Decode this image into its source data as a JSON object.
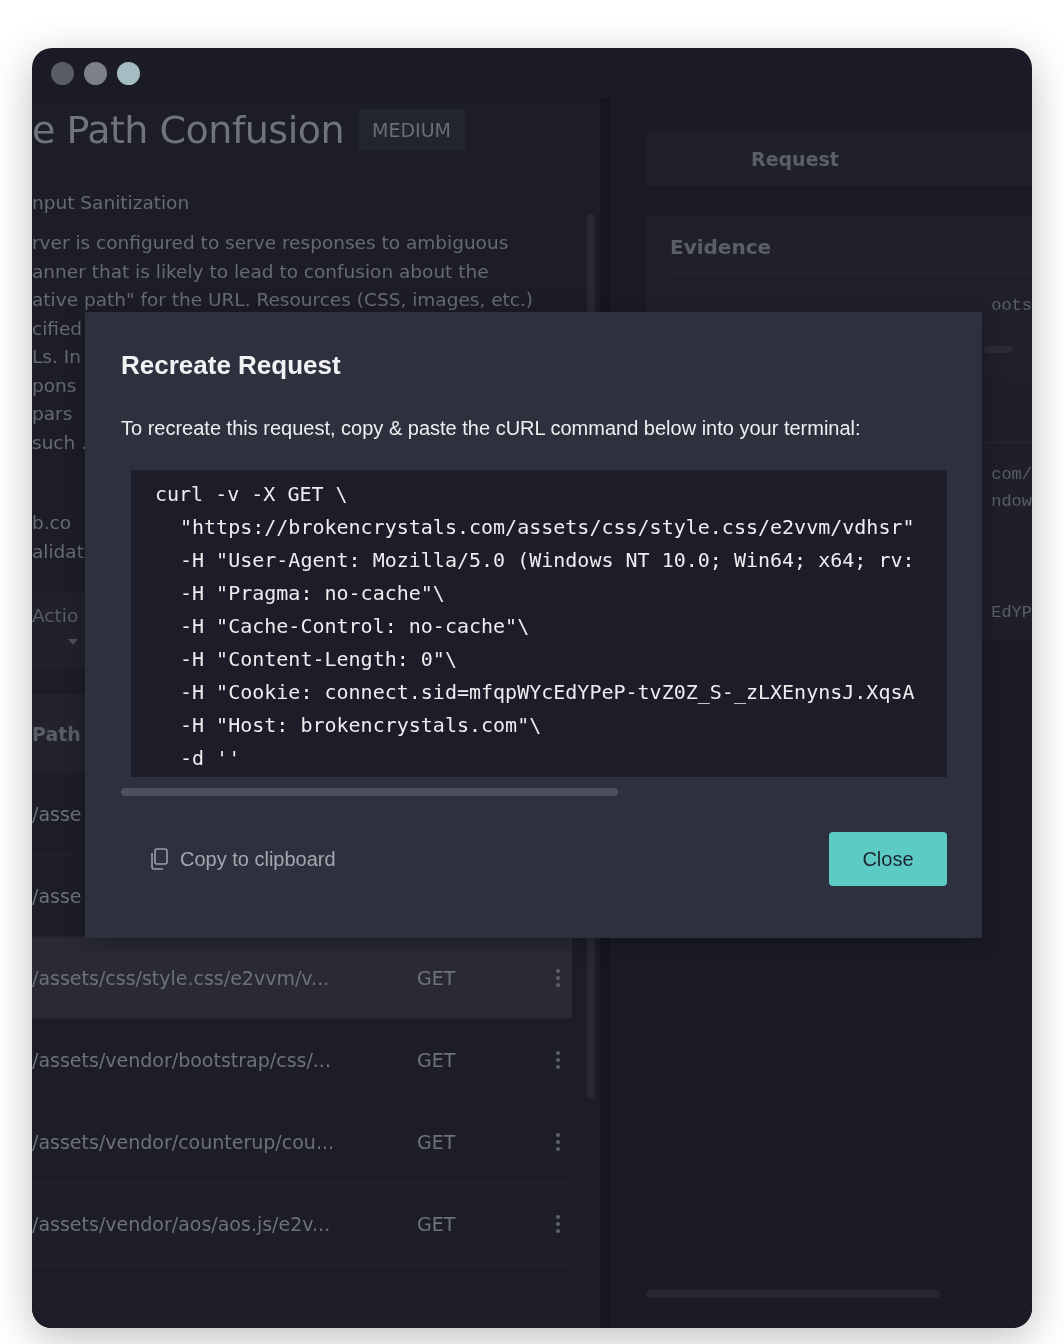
{
  "finding": {
    "title": "e Path Confusion",
    "severity": "MEDIUM",
    "category": "nput Sanitization",
    "description_lines": [
      "rver is configured to serve responses to ambiguous",
      "anner that is likely to lead to confusion about the",
      "ative path\" for the URL. Resources (CSS, images, etc.)",
      "cified",
      "Ls. In",
      "pons",
      "pars",
      "such ."
    ],
    "extra_lines": [
      "b.co",
      "alidat"
    ]
  },
  "actions_dropdown": {
    "label": "Actio"
  },
  "requests_table": {
    "columns": [
      "Path"
    ],
    "rows": [
      {
        "path": "/asse",
        "method": "",
        "selected": false
      },
      {
        "path": "/asse",
        "method": "",
        "selected": false
      },
      {
        "path": "/assets/css/style.css/e2vvm/v...",
        "method": "GET",
        "selected": true
      },
      {
        "path": "/assets/vendor/bootstrap/css/...",
        "method": "GET",
        "selected": false
      },
      {
        "path": "/assets/vendor/counterup/cou...",
        "method": "GET",
        "selected": false
      },
      {
        "path": "/assets/vendor/aos/aos.js/e2v...",
        "method": "GET",
        "selected": false
      }
    ]
  },
  "detail": {
    "request_button": "Request",
    "evidence": {
      "title": "Evidence",
      "code_fragment": "oots"
    },
    "code_fragments": [
      "com/",
      "ndow",
      "EdYP"
    ]
  },
  "modal": {
    "title": "Recreate Request",
    "instruction": "To recreate this request, copy & paste the cURL command below into your terminal:",
    "command_lines": [
      "curl -v -X GET \\",
      "\"https://brokencrystals.com/assets/css/style.css/e2vvm/vdhsr\"",
      "-H \"User-Agent: Mozilla/5.0 (Windows NT 10.0; Win64; x64; rv:",
      "-H \"Pragma: no-cache\"\\",
      "-H \"Cache-Control: no-cache\"\\",
      "-H \"Content-Length: 0\"\\",
      "-H \"Cookie: connect.sid=mfqpWYcEdYPeP-tvZ0Z_S-_zLXEnynsJ.XqsA",
      "-H \"Host: brokencrystals.com\"\\",
      "-d ''"
    ],
    "copy_label": "Copy to clipboard",
    "close_label": "Close"
  }
}
